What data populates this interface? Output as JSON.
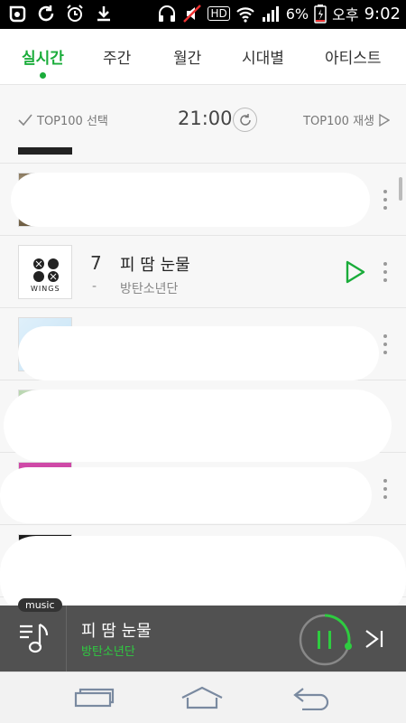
{
  "statusbar": {
    "battery": "6%",
    "ampm": "오후",
    "time": "9:02",
    "hd": "HD"
  },
  "tabs": [
    {
      "label": "실시간",
      "active": true
    },
    {
      "label": "주간",
      "active": false
    },
    {
      "label": "월간",
      "active": false
    },
    {
      "label": "시대별",
      "active": false
    },
    {
      "label": "아티스트",
      "active": false
    }
  ],
  "subheader": {
    "select_label": "TOP100 선택",
    "clock": "21:00",
    "play_all_label": "TOP100 재생"
  },
  "list": {
    "rows": [
      {
        "rank": "7",
        "change": "-",
        "title": "피 땀 눈물",
        "artist": "방탄소년단",
        "thumb_text": "WINGS"
      }
    ]
  },
  "player": {
    "tag": "music",
    "title": "피 땀 눈물",
    "artist": "방탄소년단"
  },
  "colors": {
    "accent": "#1aac3a",
    "player_bg": "#515151"
  },
  "icons": [
    "check-icon",
    "refresh-icon",
    "play-outline-icon",
    "play-triangle-icon",
    "more-vertical-icon",
    "playlist-music-icon",
    "pause-icon",
    "next-track-icon",
    "recent-apps-icon",
    "home-icon",
    "back-icon"
  ]
}
